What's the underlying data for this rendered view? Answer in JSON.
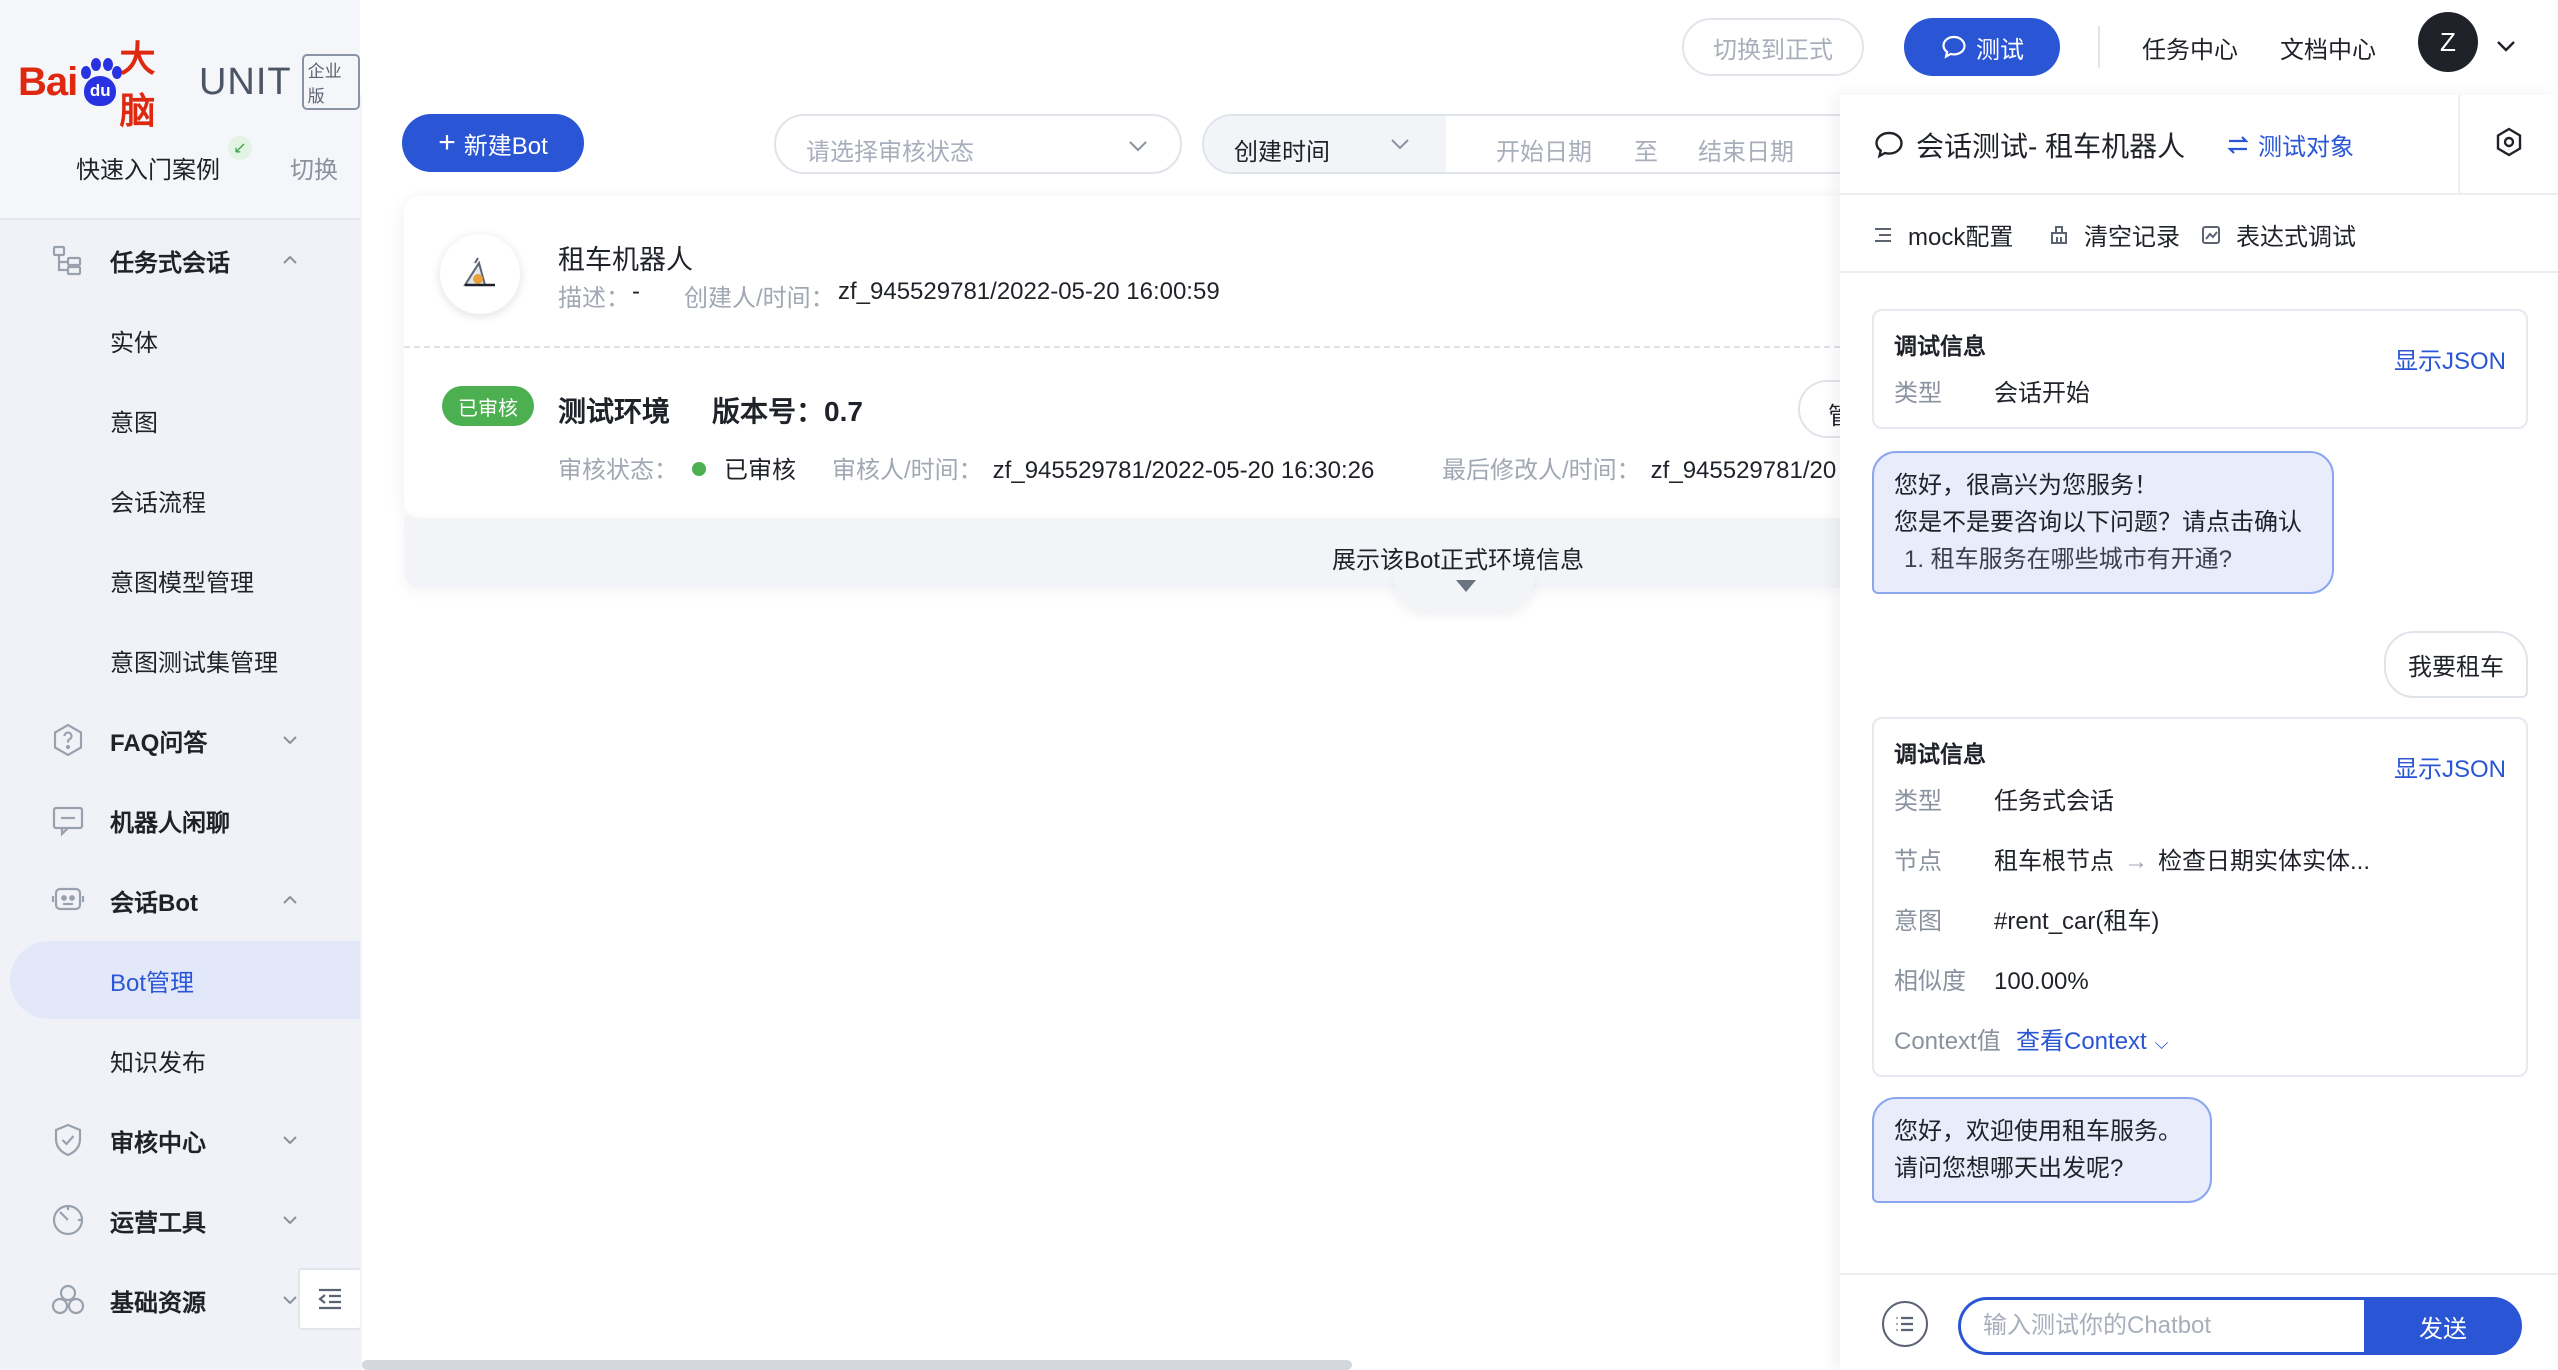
{
  "brand": {
    "logo_bai": "Bai",
    "logo_du": "du",
    "logo_dn": "大脑",
    "product": "UNIT",
    "edition": "企业版"
  },
  "quick": {
    "label": "快速入门案例",
    "switch": "切换"
  },
  "sidebar": {
    "groups": [
      {
        "label": "任务式会话",
        "icon": "task-dialog-icon",
        "expanded": true
      },
      {
        "label": "FAQ问答",
        "icon": "question-icon",
        "expanded": false
      },
      {
        "label": "机器人闲聊",
        "icon": "chat-icon",
        "expanded": false
      },
      {
        "label": "会话Bot",
        "icon": "robot-icon",
        "expanded": true
      },
      {
        "label": "审核中心",
        "icon": "shield-icon",
        "expanded": false
      },
      {
        "label": "运营工具",
        "icon": "gauge-icon",
        "expanded": false
      },
      {
        "label": "基础资源",
        "icon": "cubes-icon",
        "expanded": false
      }
    ],
    "task_items": [
      "实体",
      "意图",
      "会话流程",
      "意图模型管理",
      "意图测试集管理"
    ],
    "bot_items": [
      "Bot管理",
      "知识发布"
    ],
    "active_item": "Bot管理"
  },
  "topbar": {
    "switch_formal": "切换到正式",
    "test": "测试",
    "task_center": "任务中心",
    "doc_center": "文档中心",
    "avatar_letter": "Z"
  },
  "toolbar": {
    "new_bot": "新建Bot",
    "status_placeholder": "请选择审核状态",
    "sort_by": "创建时间",
    "start_date": "开始日期",
    "to": "至",
    "end_date": "结束日期"
  },
  "bot": {
    "name": "租车机器人",
    "desc_label": "描述：",
    "desc_value": "-",
    "creator_label": "创建人/时间：",
    "creator_value": "zf_945529781/2022-05-20 16:00:59",
    "env_tag": "已审核",
    "env_name": "测试环境",
    "version_label": "版本号：",
    "version_value": "0.7",
    "manage": "管",
    "review_status_label": "审核状态：",
    "review_status_value": "已审核",
    "reviewer_label": "审核人/时间：",
    "reviewer_value": "zf_945529781/2022-05-20 16:30:26",
    "modifier_label": "最后修改人/时间：",
    "modifier_value": "zf_945529781/20",
    "expand_text": "展示该Bot正式环境信息"
  },
  "chat": {
    "title": "会话测试- 租车机器人",
    "target": "测试对象",
    "tools": {
      "mock": "mock配置",
      "clear": "清空记录",
      "expr": "表达式调试"
    },
    "debug1": {
      "title": "调试信息",
      "show_json": "显示JSON",
      "type_label": "类型",
      "type_value": "会话开始"
    },
    "bot_msg1": {
      "line1": "您好，很高兴为您服务！",
      "line2": "您是不是要咨询以下问题？请点击确认",
      "line3": "1. 租车服务在哪些城市有开通?"
    },
    "user_msg": "我要租车",
    "debug2": {
      "title": "调试信息",
      "show_json": "显示JSON",
      "type_label": "类型",
      "type_value": "任务式会话",
      "node_label": "节点",
      "node_from": "租车根节点",
      "node_to": "检查日期实体实体...",
      "intent_label": "意图",
      "intent_value": "#rent_car(租车)",
      "sim_label": "相似度",
      "sim_value": "100.00%",
      "ctx_label": "Context值",
      "ctx_link": "查看Context"
    },
    "bot_msg2": {
      "line1": "您好，欢迎使用租车服务。",
      "line2": "请问您想哪天出发呢?"
    },
    "input_placeholder": "输入测试你的Chatbot",
    "send": "发送"
  },
  "colors": {
    "primary": "#2a56d6",
    "success": "#4caf50",
    "brand_red": "#de2910",
    "brand_blue": "#2932e1"
  }
}
